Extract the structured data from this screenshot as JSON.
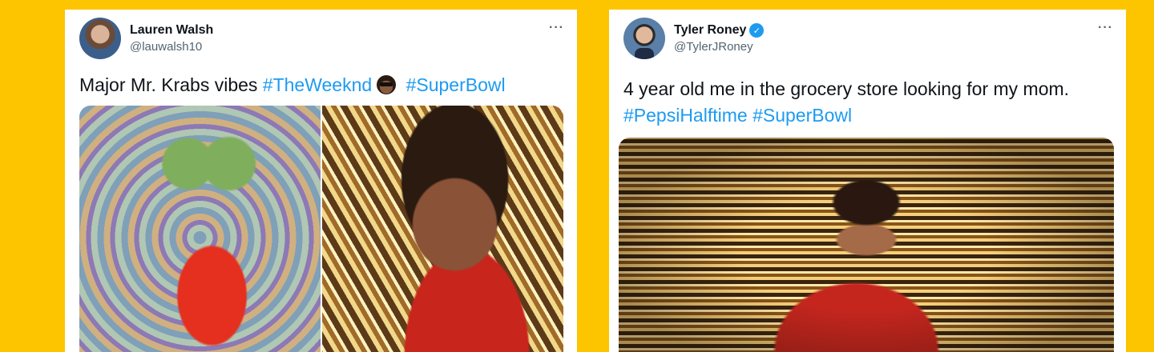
{
  "tweets": [
    {
      "display_name": "Lauren Walsh",
      "handle": "@lauwalsh10",
      "more_label": "···",
      "text_before": "Major Mr. Krabs vibes ",
      "hashtags": [
        "#TheWeeknd",
        "#SuperBowl"
      ],
      "media_count": 2
    },
    {
      "display_name": "Tyler Roney",
      "handle": "@TylerJRoney",
      "verified": true,
      "verified_mark": "✓",
      "more_label": "···",
      "text_before": "4 year old me in the grocery store looking for my mom.",
      "hashtags": [
        "#PepsiHalftime",
        "#SuperBowl"
      ],
      "media_count": 1
    }
  ],
  "colors": {
    "background": "#FDC500",
    "hashtag": "#1d9bf0",
    "verified": "#1d9bf0"
  },
  "icons": {
    "more": "more-dots-icon",
    "verified": "verified-badge-icon",
    "emoji": "sunglasses-face-emoji"
  }
}
